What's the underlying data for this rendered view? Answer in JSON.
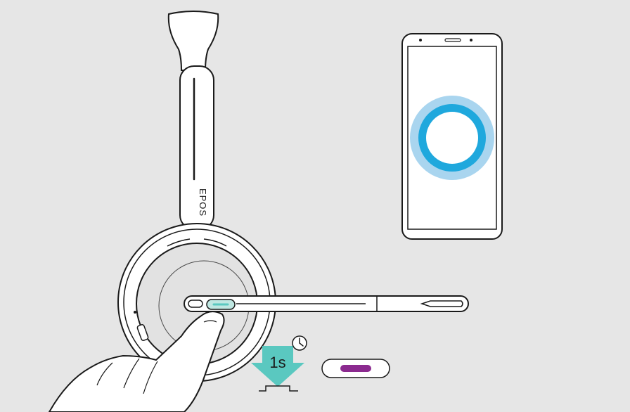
{
  "headset": {
    "brand": "EPOS"
  },
  "instruction": {
    "press_duration": "1s"
  },
  "led": {
    "color": "#8b2a8f"
  },
  "phone": {
    "indicator_inner_color": "#1fa8dd",
    "indicator_outer_color": "#a9d5ef"
  },
  "colors": {
    "accent_teal": "#5ac8c0",
    "button_highlight": "#bfe7e2"
  }
}
